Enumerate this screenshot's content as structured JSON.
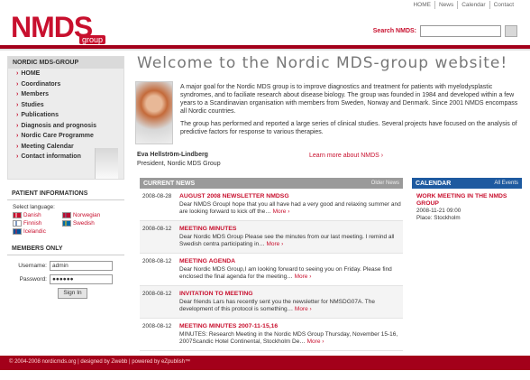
{
  "topnav": [
    "HOME",
    "News",
    "Calendar",
    "Contact"
  ],
  "logo": {
    "main": "NMDS",
    "sub": "group"
  },
  "search": {
    "label": "Search NMDS:"
  },
  "sidebar": {
    "menu_title": "NORDIC MDS-GROUP",
    "items": [
      "HOME",
      "Coordinators",
      "Members",
      "Studies",
      "Publications",
      "Diagnosis and prognosis",
      "Nordic Care Programme",
      "Meeting Calendar",
      "Contact information"
    ],
    "patient_title": "PATIENT INFORMATIONS",
    "language_label": "Select language:",
    "languages": [
      "Danish",
      "Norwegian",
      "Finnish",
      "Swedish",
      "Icelandic"
    ],
    "members_title": "MEMBERS ONLY",
    "username_label": "Username:",
    "username_value": "admin",
    "password_label": "Password:",
    "password_value": "●●●●●●",
    "signin_label": "Sign In"
  },
  "main": {
    "welcome": "Welcome to the Nordic MDS-group website!",
    "intro1": "A major goal for the Nordic MDS group is to improve diagnostics and treatment for patients with myelodysplastic syndromes, and to faciliate research about disease biology. The group was founded in 1984 and developed within a few years to a Scandinavian organisation with members from Sweden, Norway and Denmark. Since 2001 NMDS encompass all Nordic countries.",
    "intro2": "The group has performed and reported a large series of clinical studies. Several projects have focused on the analysis of predictive factors for response to various therapies.",
    "person_name": "Eva Hellström-Lindberg",
    "person_title": "President, Nordic MDS Group",
    "learn_more": "Learn more about NMDS ›"
  },
  "news": {
    "title": "CURRENT NEWS",
    "older": "Older News",
    "items": [
      {
        "date": "2008-08-28",
        "title": "AUGUST 2008 NEWSLETTER NMDSG",
        "text": "Dear NMDS GroupI hope that you all have had a very good and relaxing summer and are looking forward to kick off the…",
        "more": "More ›"
      },
      {
        "date": "2008-08-12",
        "title": "MEETING MINUTES",
        "text": "Dear Nordic MDS Group Please see the minutes from our last meeting. I remind all Swedish centra participating in…",
        "more": "More ›"
      },
      {
        "date": "2008-08-12",
        "title": "MEETING AGENDA",
        "text": "Dear Nordic MDS Group,I am looking forward to seeing you on Friday. Please find enclosed the final agenda for the meeting…",
        "more": "More ›"
      },
      {
        "date": "2008-08-12",
        "title": "INVITATION TO MEETING",
        "text": "Dear friends Lars has recently sent you the newsletter for NMSDG07A. The development of this protocol is something…",
        "more": "More ›"
      },
      {
        "date": "2008-08-12",
        "title": "MEETING MINUTES 2007-11-15,16",
        "text": "MINUTES: Research Meeting in the Nordic MDS Group Thursday, November 15-16, 2007Scandic Hotel Continental, Stockholm De…",
        "more": "More ›"
      }
    ]
  },
  "calendar": {
    "title": "CALENDAR",
    "all": "All Events",
    "item_title": "WORK MEETING IN THE NMDS GROUP",
    "item_date": "2008-11-21 09:00",
    "item_place": "Place: Stockholm"
  },
  "footer": {
    "text": "© 2004-2008 nordicmds.org | designed by Zwebb | powered by eZpublish™"
  }
}
